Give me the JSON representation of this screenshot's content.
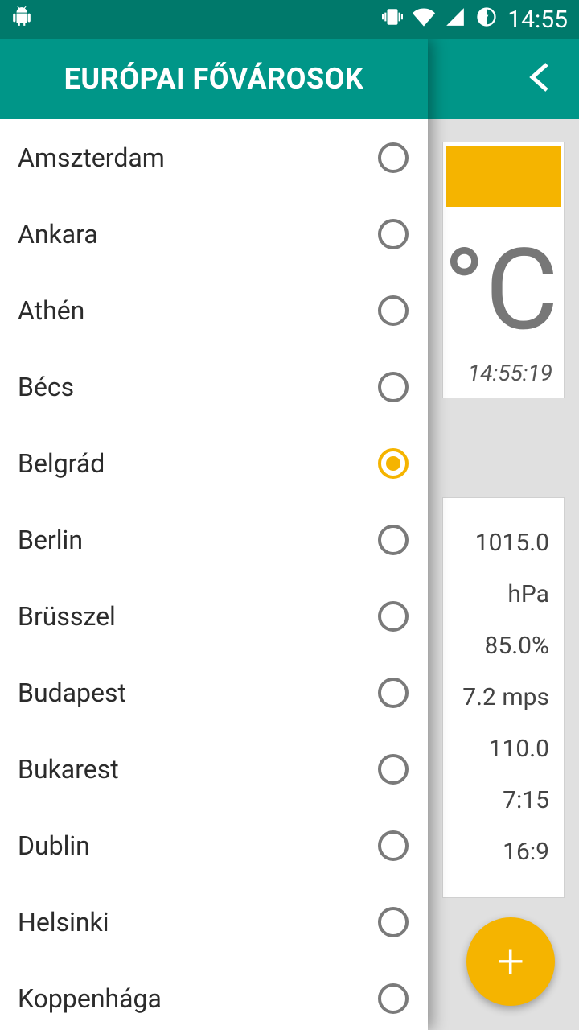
{
  "statusbar": {
    "time": "14:55"
  },
  "appbar": {
    "title": "EURÓPAI FŐVÁROSOK"
  },
  "drawer": {
    "items": [
      {
        "label": "Amszterdam",
        "selected": false
      },
      {
        "label": "Ankara",
        "selected": false
      },
      {
        "label": "Athén",
        "selected": false
      },
      {
        "label": "Bécs",
        "selected": false
      },
      {
        "label": "Belgrád",
        "selected": true
      },
      {
        "label": "Berlin",
        "selected": false
      },
      {
        "label": "Brüsszel",
        "selected": false
      },
      {
        "label": "Budapest",
        "selected": false
      },
      {
        "label": "Bukarest",
        "selected": false
      },
      {
        "label": "Dublin",
        "selected": false
      },
      {
        "label": "Helsinki",
        "selected": false
      },
      {
        "label": "Koppenhága",
        "selected": false
      }
    ]
  },
  "weather": {
    "unit": "°C",
    "timestamp": "14:55:19",
    "metrics": {
      "pressure": "1015.0 hPa",
      "humidity": "85.0%",
      "wind_speed": "7.2 mps",
      "wind_dir": "110.0",
      "sunrise": "7:15",
      "sunset": "16:9"
    }
  },
  "fab": {
    "glyph": "+"
  }
}
